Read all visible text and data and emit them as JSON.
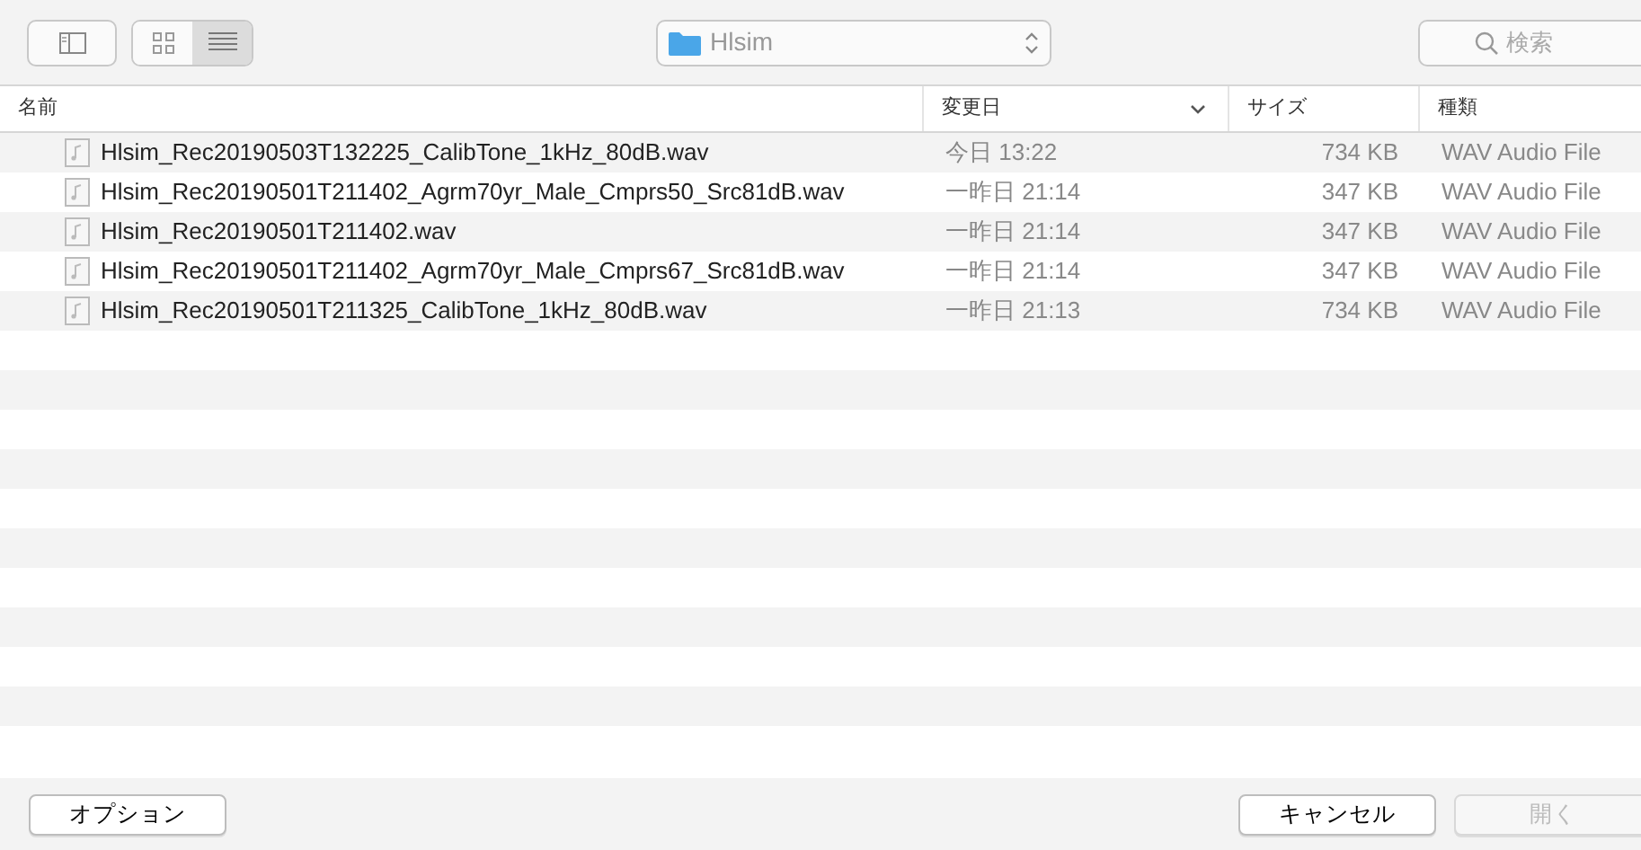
{
  "toolbar": {
    "view_modes": [
      {
        "kind": "icons",
        "selected": false
      },
      {
        "kind": "list",
        "selected": true
      }
    ],
    "location": "Hlsim",
    "search": {
      "placeholder": "検索"
    }
  },
  "table": {
    "columns": [
      {
        "label": "名前",
        "sorted": false
      },
      {
        "label": "変更日",
        "sorted": true
      },
      {
        "label": "サイズ",
        "sorted": false
      },
      {
        "label": "種類",
        "sorted": false
      }
    ],
    "rows": [
      {
        "name": "Hlsim_Rec20190503T132225_CalibTone_1kHz_80dB.wav",
        "modified": "今日 13:22",
        "size": "734 KB",
        "kind": "WAV Audio File"
      },
      {
        "name": "Hlsim_Rec20190501T211402_Agrm70yr_Male_Cmprs50_Src81dB.wav",
        "modified": "一昨日 21:14",
        "size": "347 KB",
        "kind": "WAV Audio File"
      },
      {
        "name": "Hlsim_Rec20190501T211402.wav",
        "modified": "一昨日 21:14",
        "size": "347 KB",
        "kind": "WAV Audio File"
      },
      {
        "name": "Hlsim_Rec20190501T211402_Agrm70yr_Male_Cmprs67_Src81dB.wav",
        "modified": "一昨日 21:14",
        "size": "347 KB",
        "kind": "WAV Audio File"
      },
      {
        "name": "Hlsim_Rec20190501T211325_CalibTone_1kHz_80dB.wav",
        "modified": "一昨日 21:13",
        "size": "734 KB",
        "kind": "WAV Audio File"
      }
    ]
  },
  "buttons": [
    {
      "label": "オプション",
      "disabled": false
    },
    {
      "label": "キャンセル",
      "disabled": false
    },
    {
      "label": "開く",
      "disabled": true
    }
  ]
}
